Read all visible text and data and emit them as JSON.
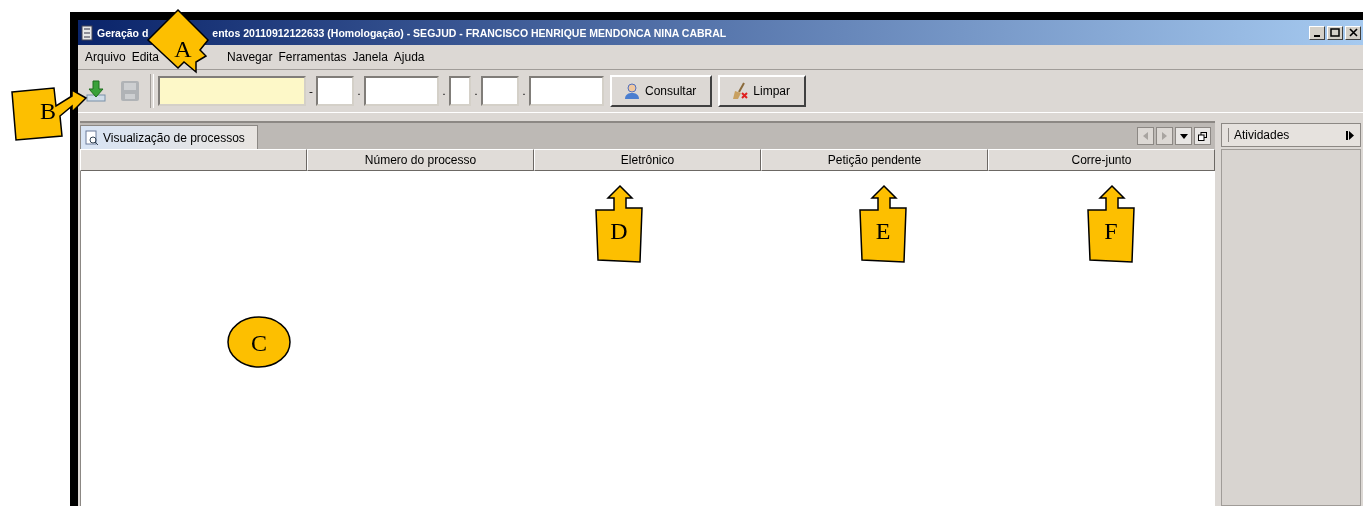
{
  "window": {
    "title_start": "Geração d",
    "title_end": "entos 20110912122633 (Homologação) - SEGJUD - FRANCISCO HENRIQUE MENDONCA NINA CABRAL"
  },
  "menu": [
    "Arquivo",
    "Edita",
    "Navegar",
    "Ferramentas",
    "Janela",
    "Ajuda"
  ],
  "toolbar": {
    "icon_buttons": [
      {
        "kind": "download",
        "disabled": false
      },
      {
        "kind": "save",
        "disabled": true
      }
    ],
    "fields": [
      {
        "highlighted": true
      },
      {
        "separator": "-",
        "highlighted": false
      },
      {
        "separator": ".",
        "highlighted": false
      },
      {
        "separator": ".",
        "highlighted": false
      },
      {
        "separator": ".",
        "highlighted": false
      },
      {
        "separator": ".",
        "highlighted": false
      }
    ],
    "buttons": [
      {
        "label": "Consultar",
        "kind": "search"
      },
      {
        "label": "Limpar",
        "kind": "clear"
      }
    ]
  },
  "tabs": [
    {
      "label": "Visualização de processos",
      "selected": true
    }
  ],
  "table": {
    "columns": [
      "",
      "Número do processo",
      "Eletrônico",
      "Petição pendente",
      "Corre-junto"
    ]
  },
  "side_panel": {
    "title": "Atividades"
  },
  "callouts": [
    {
      "label": "A",
      "kind": "diamond"
    },
    {
      "label": "B",
      "kind": "arrow-right"
    },
    {
      "label": "C",
      "kind": "circle"
    },
    {
      "label": "D",
      "kind": "arrow-up"
    },
    {
      "label": "E",
      "kind": "arrow-up"
    },
    {
      "label": "F",
      "kind": "arrow-up"
    }
  ]
}
